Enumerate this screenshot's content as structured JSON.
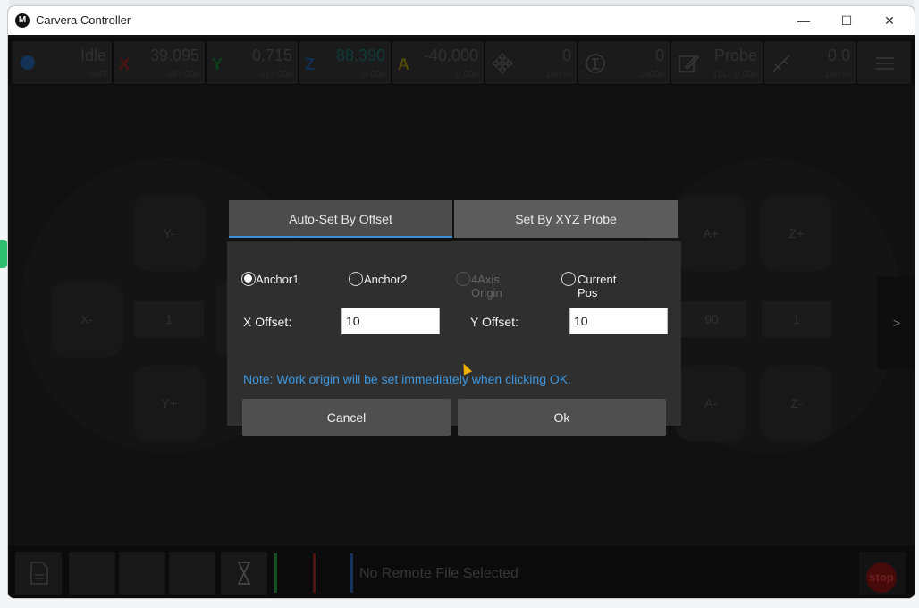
{
  "window": {
    "logo_letter": "M",
    "title": "Carvera Controller",
    "minimize_glyph": "—",
    "maximize_glyph": "☐",
    "close_glyph": "✕"
  },
  "status": {
    "state": "Idle",
    "connection": "WiFi",
    "x": {
      "label": "X",
      "value": "39.095",
      "sub": "-287.000",
      "color": "#b32020"
    },
    "y": {
      "label": "Y",
      "value": "0.715",
      "sub": "-217.000",
      "color": "#1f8a3a"
    },
    "z": {
      "label": "Z",
      "value": "88.390",
      "sub": "-3.000",
      "color": "#1b5fa8"
    },
    "a": {
      "label": "A",
      "value": "-40.000",
      "sub": "0.000",
      "color": "#a8960f"
    },
    "feed": {
      "value": "0",
      "sub": "100 %"
    },
    "spindle": {
      "value": "0",
      "sub": "10000"
    },
    "tool": {
      "value": "Probe",
      "sub": "TLO: 0.000"
    },
    "laser": {
      "value": "0.0",
      "sub": "100 %"
    }
  },
  "jog": {
    "y_minus": "Y-",
    "y_plus": "Y+",
    "x_minus": "X-",
    "a_plus": "A+",
    "a_minus": "A-",
    "z_plus": "Z+",
    "z_minus": "Z-",
    "xy_step": "1",
    "a_step": "90",
    "z_step": "1",
    "expand": ">"
  },
  "dialog": {
    "tabs": [
      {
        "label": "Auto-Set By Offset",
        "active": true
      },
      {
        "label": "Set By XYZ Probe",
        "active": false
      }
    ],
    "anchors": [
      {
        "label": "Anchor1",
        "selected": true,
        "enabled": true
      },
      {
        "label": "Anchor2",
        "selected": false,
        "enabled": true
      },
      {
        "label": "4Axis Origin",
        "selected": false,
        "enabled": false
      },
      {
        "label": "Current Pos",
        "selected": false,
        "enabled": true
      }
    ],
    "x_offset_label": "X Offset:",
    "x_offset_value": "10",
    "y_offset_label": "Y Offset:",
    "y_offset_value": "10",
    "note": "Note: Work origin will be set immediately when clicking OK.",
    "cancel_label": "Cancel",
    "ok_label": "Ok"
  },
  "bottom": {
    "file_label": "No Remote File Selected",
    "stop_label": "stop"
  }
}
